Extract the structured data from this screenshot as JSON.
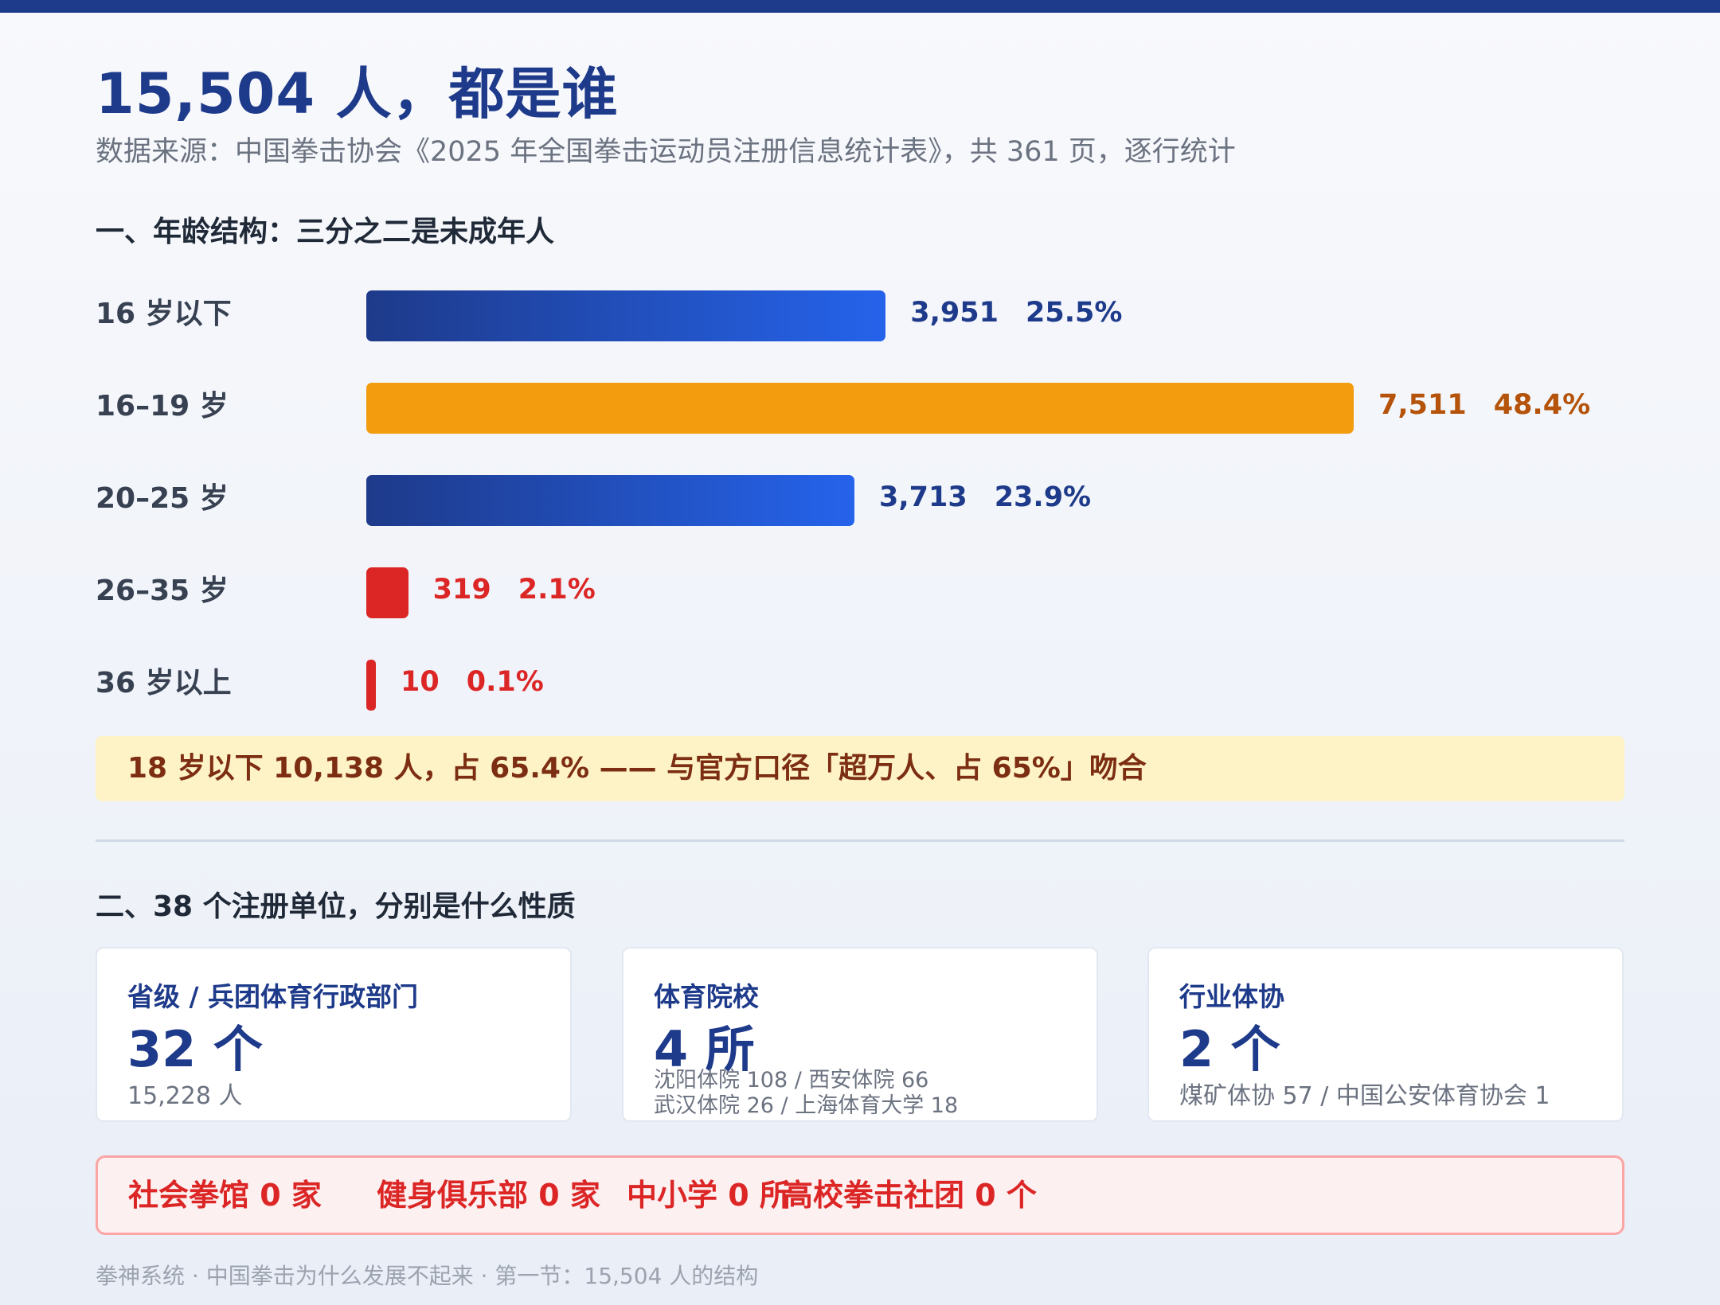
{
  "title": "15,504 人，都是谁",
  "subtitle": "数据来源：中国拳击协会《2025 年全国拳击运动员注册信息统计表》，共 361 页，逐行统计",
  "section1_title": "一、年龄结构：三分之二是未成年人",
  "chart_data": {
    "type": "bar",
    "orientation": "horizontal",
    "title": "一、年龄结构：三分之二是未成年人",
    "categories": [
      "16 岁以下",
      "16–19 岁",
      "20–25 岁",
      "26–35 岁",
      "36 岁以上"
    ],
    "values": [
      3951,
      7511,
      3713,
      319,
      10
    ],
    "value_labels": [
      "3,951",
      "7,511",
      "3,713",
      "319",
      "10"
    ],
    "percent_labels": [
      "25.5%",
      "48.4%",
      "23.9%",
      "2.1%",
      "0.1%"
    ],
    "bar_colors": [
      "blue-gradient",
      "orange",
      "blue-gradient",
      "red",
      "red"
    ],
    "colors": {
      "blue_start": "#1e3a8a",
      "blue_end": "#2563eb",
      "orange": "#f39c0e",
      "red": "#dc2626"
    },
    "grid": false,
    "legend": "none"
  },
  "callout": "18 岁以下 10,138 人，占 65.4% —— 与官方口径「超万人、占 65%」吻合",
  "section2_title": "二、38 个注册单位，分别是什么性质",
  "cards": [
    {
      "label": "省级 / 兵团体育行政部门",
      "big": "32 个",
      "detail": [
        "15,228 人"
      ]
    },
    {
      "label": "体育院校",
      "big": "4 所",
      "detail": [
        "沈阳体院 108 / 西安体院 66",
        "武汉体院 26 / 上海体育大学 18"
      ]
    },
    {
      "label": "行业体协",
      "big": "2 个",
      "detail": [
        "煤矿体协 57 / 中国公安体育协会 1"
      ]
    }
  ],
  "zero_items": [
    "社会拳馆 0 家",
    "健身俱乐部 0 家",
    "中小学 0 所",
    "高校拳击社团 0 个"
  ],
  "footer": "拳神系统 · 中国拳击为什么发展不起来 · 第一节：15,504 人的结构"
}
